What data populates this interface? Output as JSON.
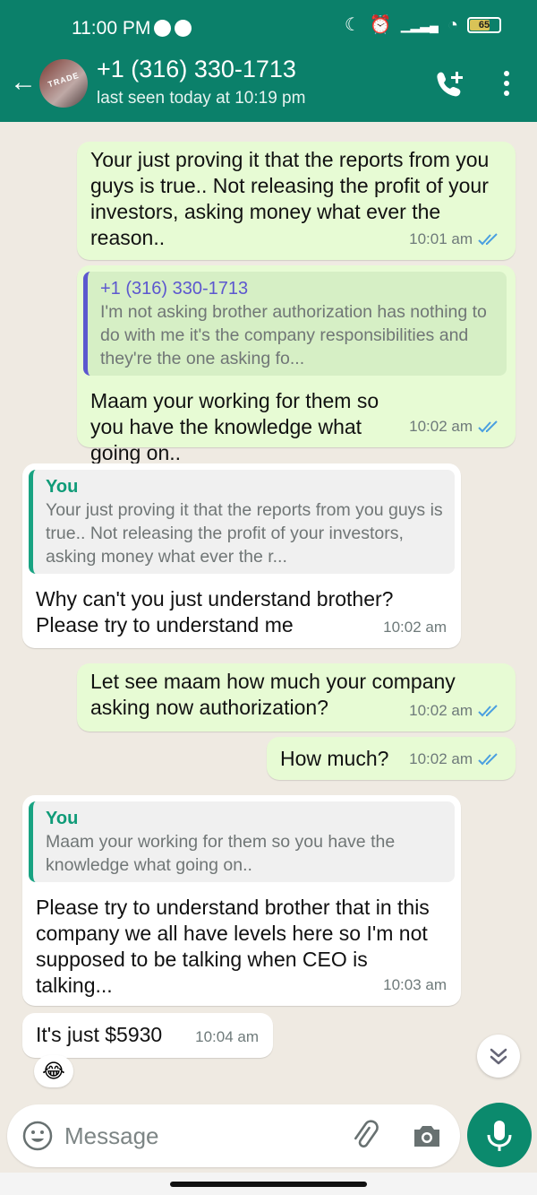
{
  "status_bar": {
    "time": "11:00 PM",
    "battery": "65"
  },
  "header": {
    "avatar_text": "TRADE",
    "contact_name": "+1 (316) 330-1713",
    "last_seen": "last seen today at 10:19 pm"
  },
  "messages": [
    {
      "direction": "out",
      "text": "Your just proving it that the reports from you guys is true.. Not releasing the profit of your investors, asking money what ever the reason..",
      "time": "10:01 am",
      "read": true
    },
    {
      "direction": "out",
      "quote_name": "+1 (316) 330-1713",
      "quote_text": "I'm not asking brother authorization has nothing to do with me it's the company responsibilities and they're the one asking fo...",
      "text": "Maam your working for them so you have the knowledge what going on..",
      "time": "10:02 am",
      "read": true
    },
    {
      "direction": "in",
      "quote_name": "You",
      "quote_text": "Your just proving it that the reports from you guys is true.. Not releasing the profit of your investors, asking money what ever the r...",
      "text": "Why can't you just understand brother? Please try to understand me",
      "time": "10:02 am"
    },
    {
      "direction": "out",
      "text": "Let see maam how much your company asking now authorization?",
      "time": "10:02 am",
      "read": true
    },
    {
      "direction": "out",
      "text": "How much?",
      "time": "10:02 am",
      "read": true
    },
    {
      "direction": "in",
      "quote_name": "You",
      "quote_text": "Maam your working for them so you have the knowledge what going on..",
      "text": "Please try to understand brother that in this company we all have levels here so I'm not supposed to be talking when CEO is talking...",
      "time": "10:03 am"
    },
    {
      "direction": "in",
      "text": "It's just $5930",
      "time": "10:04 am",
      "reaction": "😂"
    }
  ],
  "input": {
    "placeholder": "Message"
  },
  "colors": {
    "header": "#0b806a",
    "outgoing_bubble": "#e7fbd4",
    "incoming_bubble": "#ffffff",
    "chat_bg": "#efeae2",
    "read_ticks": "#4a9fe0",
    "send_button": "#0b8a6d"
  }
}
